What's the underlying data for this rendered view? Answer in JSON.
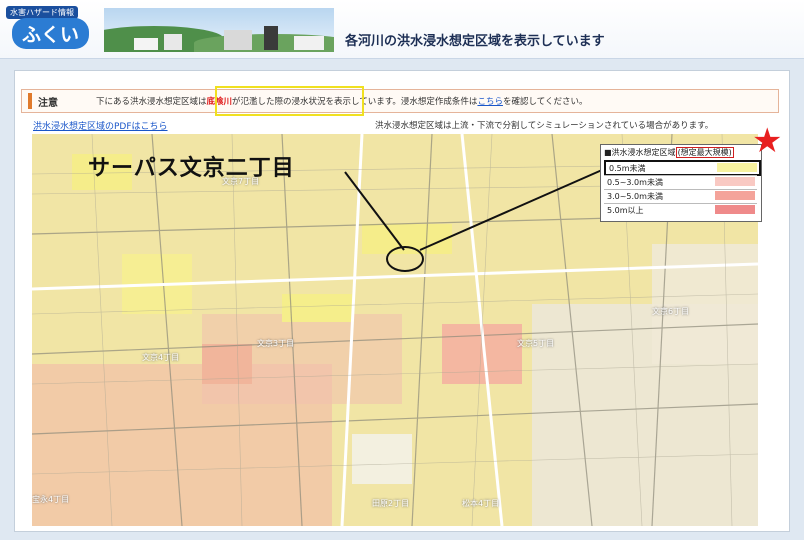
{
  "header": {
    "logo_badge": "水害ハザード情報",
    "logo_name": "ふくい",
    "title": "各河川の洪水浸水想定区域を表示しています"
  },
  "notice": {
    "label": "注意",
    "text_before": "下にある洪水浸水想定区域は",
    "river": "底喰川",
    "text_middle": "が氾濫した際の浸水状況を表示しています。浸水想定作成条件は",
    "link": "こちら",
    "text_after": "を確認してください。"
  },
  "pdf_link": "洪水浸水想定区域のPDFはこちら",
  "note": "洪水浸水想定区域は上流・下流で分割してシミュレーションされている場合があります。",
  "overlay_label": "サーパス文京二丁目",
  "legend": {
    "header": "■洪水浸水想定区域",
    "scale": "(想定最大規模)",
    "items": [
      {
        "label": "0.5m未満",
        "color": "#f7f2a0"
      },
      {
        "label": "0.5~3.0m未満",
        "color": "#f9c9c3"
      },
      {
        "label": "3.0~5.0m未満",
        "color": "#f4a39a"
      },
      {
        "label": "5.0m以上",
        "color": "#ef8a8a"
      }
    ]
  },
  "map_labels": {
    "bunkyo3": "文京3丁目",
    "bunkyo4": "文京4丁目",
    "bunkyo5": "文京5丁目",
    "bunkyo6": "文京6丁目",
    "bunkyo7": "文京7丁目",
    "hoei": "宝永4丁目",
    "tawara": "田原2丁目",
    "matsumoto": "松本4丁目"
  }
}
